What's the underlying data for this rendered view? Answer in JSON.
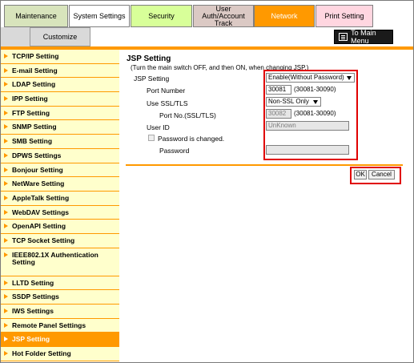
{
  "tabs": {
    "maintenance": "Maintenance",
    "system_settings": "System Settings",
    "security": "Security",
    "user_auth_line1": "User Auth/Account",
    "user_auth_line2": "Track",
    "network": "Network",
    "print_setting": "Print Setting",
    "customize": "Customize"
  },
  "main_menu_label": "To Main Menu",
  "sidebar": {
    "items": [
      {
        "label": "TCP/IP Setting"
      },
      {
        "label": "E-mail Setting"
      },
      {
        "label": "LDAP Setting"
      },
      {
        "label": "IPP Setting"
      },
      {
        "label": "FTP Setting"
      },
      {
        "label": "SNMP Setting"
      },
      {
        "label": "SMB Setting"
      },
      {
        "label": "DPWS Settings"
      },
      {
        "label": "Bonjour Setting"
      },
      {
        "label": "NetWare Setting"
      },
      {
        "label": "AppleTalk Setting"
      },
      {
        "label": "WebDAV Settings"
      },
      {
        "label": "OpenAPI Setting"
      },
      {
        "label": "TCP Socket Setting"
      },
      {
        "label": "IEEE802.1X Authentication Setting"
      },
      {
        "label": "LLTD Setting"
      },
      {
        "label": "SSDP Settings"
      },
      {
        "label": "IWS Settings"
      },
      {
        "label": "Remote Panel Settings"
      },
      {
        "label": "JSP Setting"
      },
      {
        "label": "Hot Folder Setting"
      }
    ]
  },
  "form": {
    "title": "JSP Setting",
    "note": "(Turn the main switch OFF, and then ON, when changing JSP.)",
    "jsp_setting_label": "JSP Setting",
    "jsp_setting_value": "Enable(Without Password)",
    "port_number_label": "Port Number",
    "port_number_value": "30081",
    "port_number_range": "(30081-30090)",
    "use_ssl_label": "Use SSL/TLS",
    "use_ssl_value": "Non-SSL Only",
    "port_ssl_label": "Port No.(SSL/TLS)",
    "port_ssl_value": "30082",
    "port_ssl_range": "(30081-30090)",
    "user_id_label": "User ID",
    "user_id_value": "UnKnown",
    "password_changed_label": "Password is changed.",
    "password_label": "Password",
    "password_value": ""
  },
  "buttons": {
    "ok": "OK",
    "cancel": "Cancel"
  },
  "colors": {
    "accent": "#ff9900",
    "highlight_box": "#e00000"
  }
}
